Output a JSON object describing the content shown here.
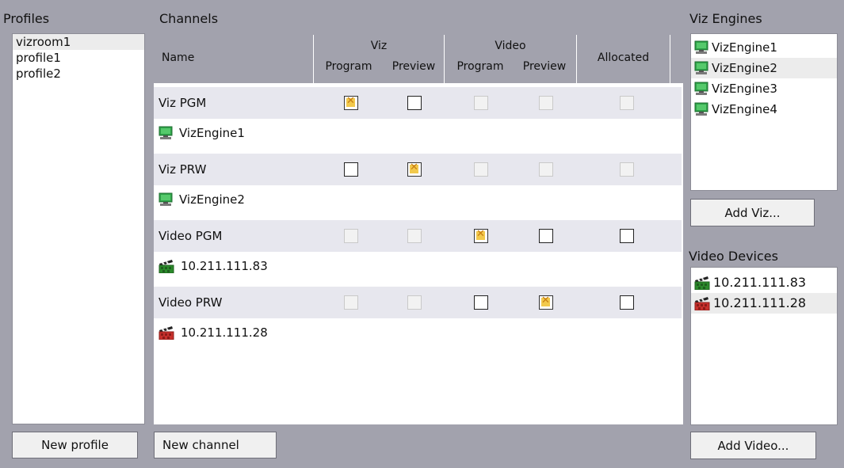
{
  "profiles": {
    "title": "Profiles",
    "items": [
      "vizroom1",
      "profile1",
      "profile2"
    ],
    "selected_index": 0,
    "new_button": "New profile"
  },
  "channels": {
    "title": "Channels",
    "headers": {
      "name": "Name",
      "viz_group": "Viz",
      "viz_program": "Program",
      "viz_preview": "Preview",
      "video_group": "Video",
      "video_program": "Program",
      "video_preview": "Preview",
      "allocated": "Allocated"
    },
    "rows": [
      {
        "name": "Viz PGM",
        "device": "VizEngine1",
        "device_icon": "monitor-icon-green",
        "viz_program": "checked",
        "viz_preview": "unchecked",
        "video_program": "disabled",
        "video_preview": "disabled",
        "allocated": "disabled"
      },
      {
        "name": "Viz PRW",
        "device": "VizEngine2",
        "device_icon": "monitor-icon-green",
        "viz_program": "unchecked",
        "viz_preview": "checked",
        "video_program": "disabled",
        "video_preview": "disabled",
        "allocated": "disabled"
      },
      {
        "name": "Video PGM",
        "device": "10.211.111.83",
        "device_icon": "clapperboard-icon-green",
        "viz_program": "disabled",
        "viz_preview": "disabled",
        "video_program": "checked",
        "video_preview": "unchecked",
        "allocated": "unchecked"
      },
      {
        "name": "Video PRW",
        "device": "10.211.111.28",
        "device_icon": "clapperboard-icon-red",
        "viz_program": "disabled",
        "viz_preview": "disabled",
        "video_program": "unchecked",
        "video_preview": "checked",
        "allocated": "unchecked"
      }
    ],
    "new_button": "New channel"
  },
  "viz_engines": {
    "title": "Viz Engines",
    "items": [
      "VizEngine1",
      "VizEngine2",
      "VizEngine3",
      "VizEngine4"
    ],
    "selected_index": 1,
    "add_button": "Add Viz..."
  },
  "video_devices": {
    "title": "Video Devices",
    "items": [
      {
        "label": "10.211.111.83",
        "icon": "clapperboard-icon-green"
      },
      {
        "label": "10.211.111.28",
        "icon": "clapperboard-icon-red"
      }
    ],
    "selected_index": 1,
    "add_button": "Add Video..."
  },
  "colors": {
    "background": "#a2a2ad",
    "channel_row": "#e7e7ee",
    "check_fill": "#f2c94c",
    "check_mark": "#c77d12",
    "monitor_green": "#2fa34a",
    "clap_green": "#2b8a2b",
    "clap_red": "#c8302c"
  }
}
